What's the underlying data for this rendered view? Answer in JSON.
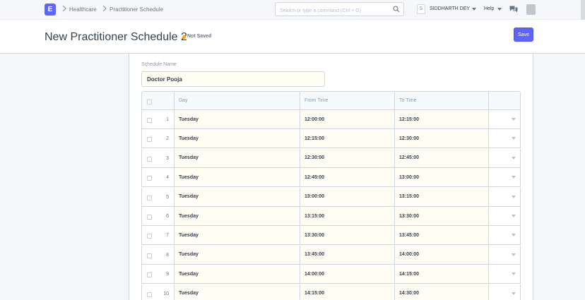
{
  "navbar": {
    "logo": "E",
    "breadcrumbs": [
      "Healthcare",
      "Practitioner Schedule"
    ],
    "search_placeholder": "Search or type a command (Ctrl + G)",
    "avatar_initial": "S",
    "user_name": "SIDDHARTH DEY",
    "help_label": "Help"
  },
  "page_head": {
    "title": "New Practitioner Schedule 2",
    "status": "Not Saved",
    "status_color": "#ffa00a",
    "save_label": "Save",
    "accent": "#5e64ff"
  },
  "form": {
    "schedule_name_label": "Schedule Name",
    "schedule_name_value": "Doctor Pooja",
    "table": {
      "columns": [
        "Day",
        "From Time",
        "To Time"
      ],
      "rows": [
        {
          "idx": "1",
          "day": "Tuesday",
          "from": "12:00:00",
          "to": "12:15:00"
        },
        {
          "idx": "2",
          "day": "Tuesday",
          "from": "12:15:00",
          "to": "12:30:00"
        },
        {
          "idx": "3",
          "day": "Tuesday",
          "from": "12:30:00",
          "to": "12:45:00"
        },
        {
          "idx": "4",
          "day": "Tuesday",
          "from": "12:45:00",
          "to": "13:00:00"
        },
        {
          "idx": "5",
          "day": "Tuesday",
          "from": "13:00:00",
          "to": "13:15:00"
        },
        {
          "idx": "6",
          "day": "Tuesday",
          "from": "13:15:00",
          "to": "13:30:00"
        },
        {
          "idx": "7",
          "day": "Tuesday",
          "from": "13:30:00",
          "to": "13:45:00"
        },
        {
          "idx": "8",
          "day": "Tuesday",
          "from": "13:45:00",
          "to": "14:00:00"
        },
        {
          "idx": "9",
          "day": "Tuesday",
          "from": "14:00:00",
          "to": "14:15:00"
        },
        {
          "idx": "10",
          "day": "Tuesday",
          "from": "14:15:00",
          "to": "14:30:00"
        }
      ]
    }
  }
}
